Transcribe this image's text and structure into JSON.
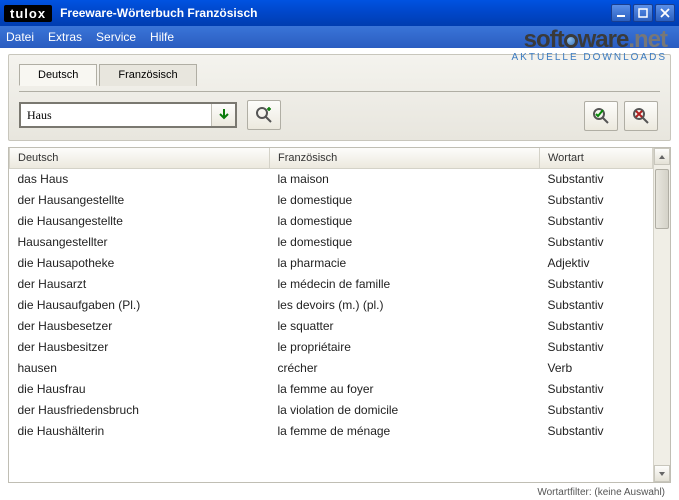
{
  "window": {
    "logo": "tulox",
    "title": "Freeware-Wörterbuch Französisch"
  },
  "menu": {
    "items": [
      "Datei",
      "Extras",
      "Service",
      "Hilfe"
    ]
  },
  "tabs": {
    "active": "Deutsch",
    "items": [
      "Deutsch",
      "Französisch"
    ]
  },
  "search": {
    "value": "Haus"
  },
  "columns": {
    "de": "Deutsch",
    "fr": "Französisch",
    "wa": "Wortart"
  },
  "rows": [
    {
      "de": "das Haus",
      "fr": "la maison",
      "wa": "Substantiv"
    },
    {
      "de": "der Hausangestellte",
      "fr": "le domestique",
      "wa": "Substantiv"
    },
    {
      "de": "die Hausangestellte",
      "fr": "la domestique",
      "wa": "Substantiv"
    },
    {
      "de": "Hausangestellter",
      "fr": "le domestique",
      "wa": "Substantiv"
    },
    {
      "de": "die Hausapotheke",
      "fr": "la pharmacie",
      "wa": "Adjektiv"
    },
    {
      "de": "der Hausarzt",
      "fr": "le médecin de famille",
      "wa": "Substantiv"
    },
    {
      "de": "die Hausaufgaben (Pl.)",
      "fr": "les devoirs (m.) (pl.)",
      "wa": "Substantiv"
    },
    {
      "de": "der Hausbesetzer",
      "fr": "le squatter",
      "wa": "Substantiv"
    },
    {
      "de": "der Hausbesitzer",
      "fr": "le propriétaire",
      "wa": "Substantiv"
    },
    {
      "de": "hausen",
      "fr": "crécher",
      "wa": "Verb"
    },
    {
      "de": "die Hausfrau",
      "fr": "la femme au foyer",
      "wa": "Substantiv"
    },
    {
      "de": "der Hausfriedensbruch",
      "fr": "la violation de domicile",
      "wa": "Substantiv"
    },
    {
      "de": "die Haushälterin",
      "fr": "la femme de ménage",
      "wa": "Substantiv"
    }
  ],
  "status": {
    "filter": "Wortartfilter: (keine Auswahl)"
  },
  "watermark": {
    "line1a": "soft",
    "line1b": "ware",
    "line1c": ".net",
    "line2": "AKTUELLE DOWNLOADS"
  }
}
